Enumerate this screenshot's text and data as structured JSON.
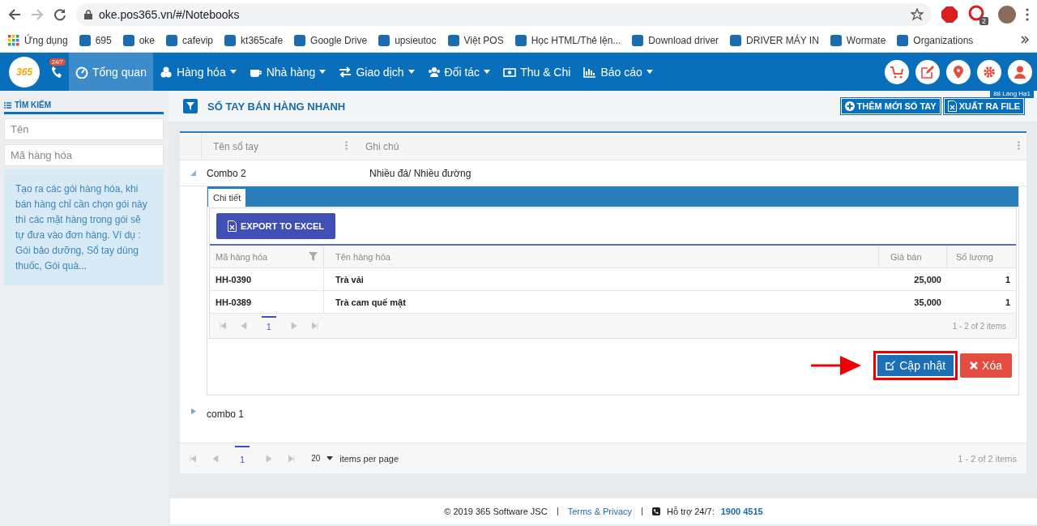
{
  "browser": {
    "url": "oke.pos365.vn/#/Notebooks",
    "extension_badge": "2",
    "bookmarks": [
      {
        "label": "Ứng dụng"
      },
      {
        "label": "695"
      },
      {
        "label": "oke"
      },
      {
        "label": "cafevip"
      },
      {
        "label": "kt365cafe"
      },
      {
        "label": "Google Drive"
      },
      {
        "label": "upsieutoc"
      },
      {
        "label": "Việt POS"
      },
      {
        "label": "Học HTML/Thẻ lện..."
      },
      {
        "label": "Download driver"
      },
      {
        "label": "DRIVER MÁY IN"
      },
      {
        "label": "Wormate"
      },
      {
        "label": "Organizations"
      }
    ]
  },
  "nav": {
    "logo": "365",
    "hotline_badge": "24/7",
    "location_tag": "88 Láng Hạ1",
    "items": [
      {
        "label": "Tổng quan",
        "selected": true,
        "has_caret": false
      },
      {
        "label": "Hàng hóa",
        "selected": false,
        "has_caret": true
      },
      {
        "label": "Nhà hàng",
        "selected": false,
        "has_caret": true
      },
      {
        "label": "Giao dịch",
        "selected": false,
        "has_caret": true
      },
      {
        "label": "Đối tác",
        "selected": false,
        "has_caret": true
      },
      {
        "label": "Thu & Chi",
        "selected": false,
        "has_caret": false
      },
      {
        "label": "Báo cáo",
        "selected": false,
        "has_caret": true
      }
    ]
  },
  "sidebar": {
    "title": "TÌM KIẾM",
    "fields": [
      {
        "placeholder": "Tên"
      },
      {
        "placeholder": "Mã hàng hóa"
      }
    ],
    "note": "Tạo ra các gói hàng hóa, khi bán hàng chỉ cần chọn gói này thì các mặt hàng trong gói sẽ tự đưa vào đơn hàng. Ví dụ : Gói bảo dưỡng, Sổ tay dùng thuốc, Gói quà..."
  },
  "page": {
    "title": "SỔ TAY BÁN HÀNG NHANH",
    "actions": [
      {
        "label": "THÊM MỚI SỔ TAY",
        "kind": "add"
      },
      {
        "label": "XUẤT RA FILE",
        "kind": "export"
      }
    ]
  },
  "grid": {
    "columns": [
      "Tên sổ tay",
      "Ghi chú"
    ],
    "rows": [
      {
        "name": "Combo 2",
        "note": "Nhiều đá/ Nhiều đường",
        "expanded": true
      },
      {
        "name": "combo 1",
        "expanded": false
      }
    ],
    "detail": {
      "tab": "Chi tiết",
      "export_button": "EXPORT TO EXCEL",
      "columns": [
        "Mã hàng hóa",
        "Tên hàng hóa",
        "Giá bán",
        "Số lượng"
      ],
      "rows": [
        [
          "HH-0390",
          "Trà vải",
          "25,000",
          "1"
        ],
        [
          "HH-0389",
          "Trà cam quế mật",
          "35,000",
          "1"
        ]
      ],
      "page": "1",
      "summary": "1 - 2 of 2 items",
      "buttons": [
        {
          "label": "Cập nhật",
          "kind": "update",
          "highlighted": true
        },
        {
          "label": "Xóa",
          "kind": "delete",
          "highlighted": false
        }
      ]
    },
    "pager": {
      "page": "1",
      "page_size": "20",
      "per_page_label": "items per page",
      "summary": "1 - 2 of 2 items"
    }
  },
  "footer": {
    "copyright": "© 2019 365 Software JSC",
    "link": "Terms & Privacy",
    "support_label": "Hỗ trợ 24/7:",
    "phone": "1900 4515"
  }
}
